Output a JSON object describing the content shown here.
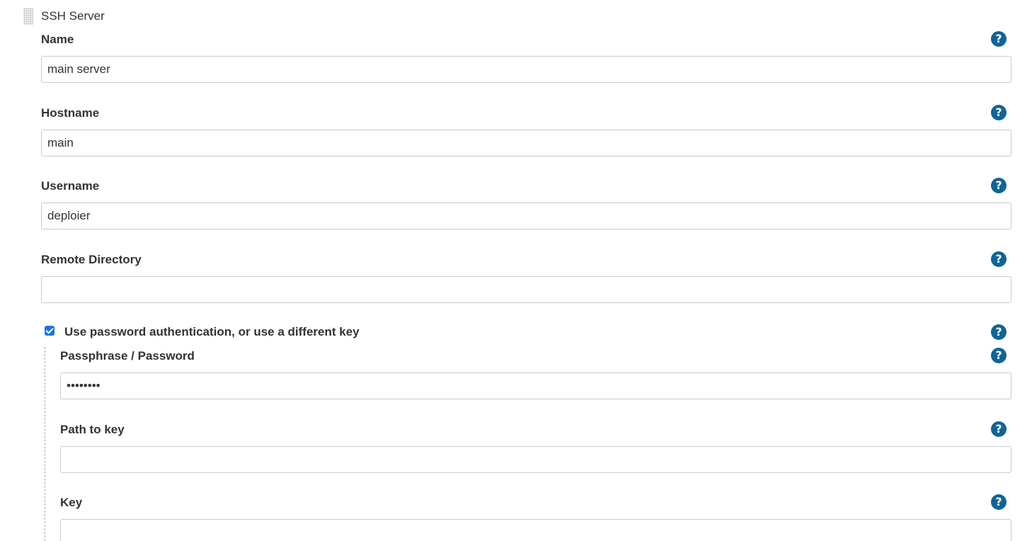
{
  "section": {
    "title": "SSH Server"
  },
  "help": {
    "glyph": "?"
  },
  "fields": {
    "name": {
      "label": "Name",
      "value": "main server"
    },
    "hostname": {
      "label": "Hostname",
      "value": "main"
    },
    "username": {
      "label": "Username",
      "value": "deploier"
    },
    "remote_directory": {
      "label": "Remote Directory",
      "value": ""
    },
    "use_password": {
      "label": "Use password authentication, or use a different key",
      "checked": true
    },
    "passphrase": {
      "label": "Passphrase / Password",
      "value": "••••••••"
    },
    "path_to_key": {
      "label": "Path to key",
      "value": ""
    },
    "key": {
      "label": "Key",
      "value": ""
    }
  },
  "colors": {
    "help_icon": "#106497",
    "checkbox": "#1a73e8",
    "input_border": "#c9c9c9",
    "text": "#333333"
  }
}
